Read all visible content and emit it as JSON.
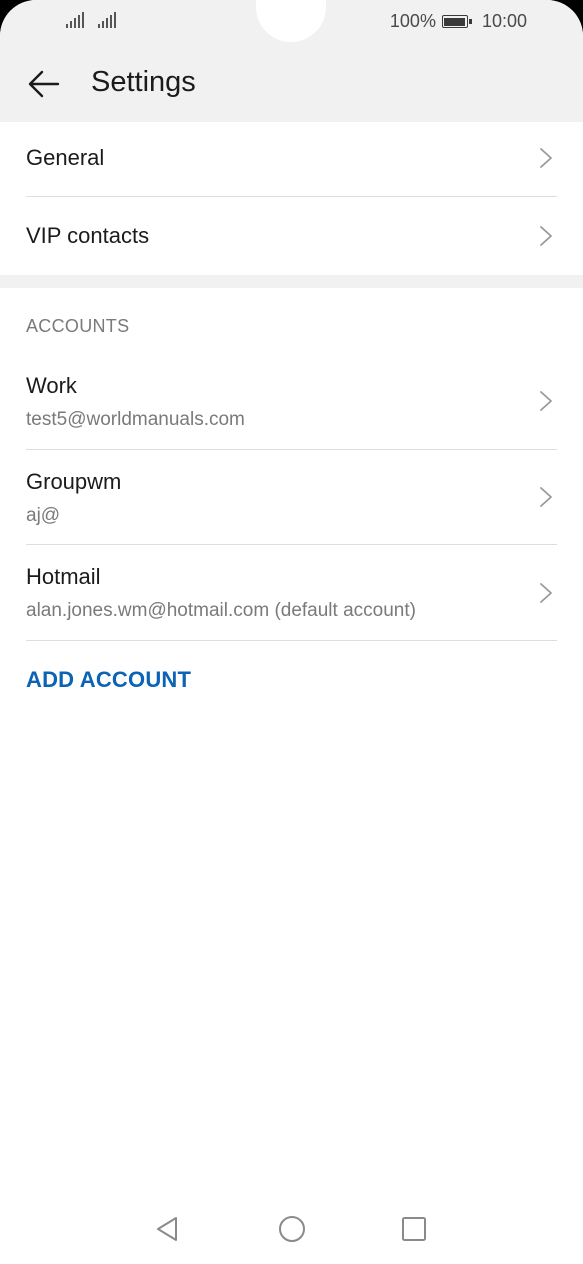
{
  "status_bar": {
    "battery_text": "100%",
    "time": "10:00",
    "icons": [
      "signal-icon",
      "signal-icon",
      "battery-icon"
    ]
  },
  "header": {
    "title": "Settings",
    "back_icon": "arrow-left-icon"
  },
  "menu": [
    {
      "label": "General"
    },
    {
      "label": "VIP contacts"
    }
  ],
  "accounts": {
    "header": "ACCOUNTS",
    "items": [
      {
        "name": "Work",
        "email": "test5@worldmanuals.com"
      },
      {
        "name": "Groupwm",
        "email": "aj@"
      },
      {
        "name": "Hotmail",
        "email": "alan.jones.wm@hotmail.com (default account)"
      }
    ],
    "add_label": "ADD ACCOUNT"
  },
  "nav_bar": {
    "icons": [
      "back-triangle-icon",
      "home-circle-icon",
      "recents-square-icon"
    ]
  },
  "colors": {
    "accent": "#0b63b5",
    "header_bg": "#f1f1f1",
    "text_primary": "#1b1b1b",
    "text_secondary": "#7a7a7a"
  }
}
